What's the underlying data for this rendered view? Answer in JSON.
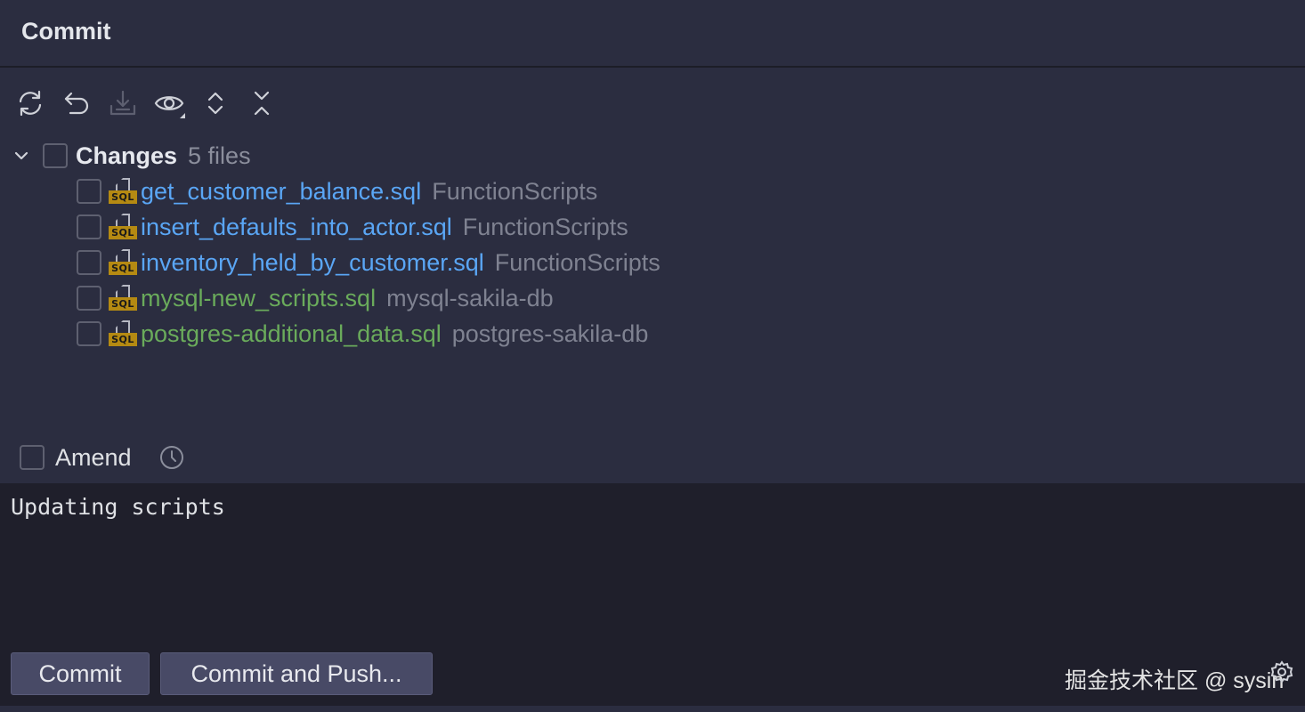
{
  "header": {
    "title": "Commit"
  },
  "toolbar": {
    "buttons": [
      {
        "icon": "refresh-icon"
      },
      {
        "icon": "rollback-icon"
      },
      {
        "icon": "shelve-icon",
        "disabled": true
      },
      {
        "icon": "eye-icon"
      },
      {
        "icon": "expand-all-icon"
      },
      {
        "icon": "collapse-all-icon"
      }
    ]
  },
  "changes": {
    "label": "Changes",
    "count": "5 files",
    "files": [
      {
        "name": "get_customer_balance.sql",
        "path": "FunctionScripts",
        "status": "modified",
        "icon_badge": "SQL"
      },
      {
        "name": "insert_defaults_into_actor.sql",
        "path": "FunctionScripts",
        "status": "modified",
        "icon_badge": "SQL"
      },
      {
        "name": "inventory_held_by_customer.sql",
        "path": "FunctionScripts",
        "status": "modified",
        "icon_badge": "SQL"
      },
      {
        "name": "mysql-new_scripts.sql",
        "path": "mysql-sakila-db",
        "status": "added",
        "icon_badge": "SQL"
      },
      {
        "name": "postgres-additional_data.sql",
        "path": "postgres-sakila-db",
        "status": "added",
        "icon_badge": "SQL"
      }
    ]
  },
  "amend": {
    "label": "Amend"
  },
  "commit_message": {
    "value": "Updating scripts"
  },
  "actions": {
    "commit_label": "Commit",
    "commit_push_label": "Commit and Push..."
  },
  "watermark": {
    "text": "掘金技术社区 @ sysin"
  },
  "colors": {
    "background": "#2b2d40",
    "modified_file": "#5aa6f5",
    "added_file": "#6aab5b",
    "path_text": "#7f8291",
    "message_bg": "#1f1f2b",
    "button_bg": "#484a66"
  }
}
